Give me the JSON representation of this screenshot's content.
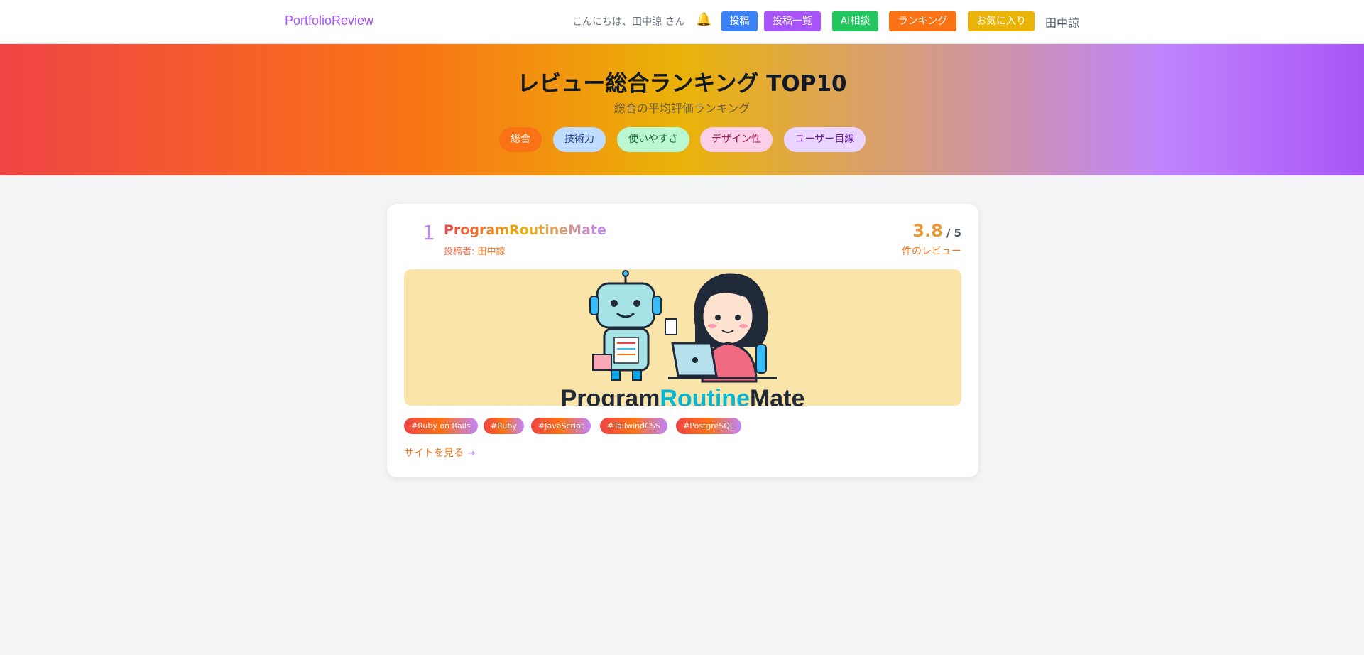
{
  "header": {
    "logo": "PortfolioReview",
    "greeting": "こんにちは、田中諒 さん",
    "bell_icon": "bell-icon",
    "nav": [
      "投稿",
      "投稿一覧",
      "AI相談",
      "ランキング",
      "お気に入り"
    ],
    "user_name": "田中諒"
  },
  "hero": {
    "title": "レビュー総合ランキング TOP10",
    "subtitle": "総合の平均評価ランキング",
    "tabs": [
      "総合",
      "技術力",
      "使いやすさ",
      "デザイン性",
      "ユーザー目線"
    ],
    "active_tab": "総合"
  },
  "ranking": [
    {
      "rank": "1",
      "title": "ProgramRoutineMate",
      "author_label": "投稿者: ",
      "author": "田中諒",
      "score": "3.8",
      "score_max": "/ 5",
      "review_label": "件のレビュー",
      "banner_text": {
        "a": "Program",
        "b": "Routine",
        "c": "Mate"
      },
      "tags": [
        "#Ruby on Rails",
        "#Ruby",
        "#JavaScript",
        "#TailwindCSS",
        "#PostgreSQL"
      ],
      "link_label": "サイトを見る",
      "link_arrow": "→"
    }
  ],
  "colors": {
    "accent_purple": "#a855f7",
    "accent_orange": "#f97316",
    "background": "#f3f4f6"
  }
}
